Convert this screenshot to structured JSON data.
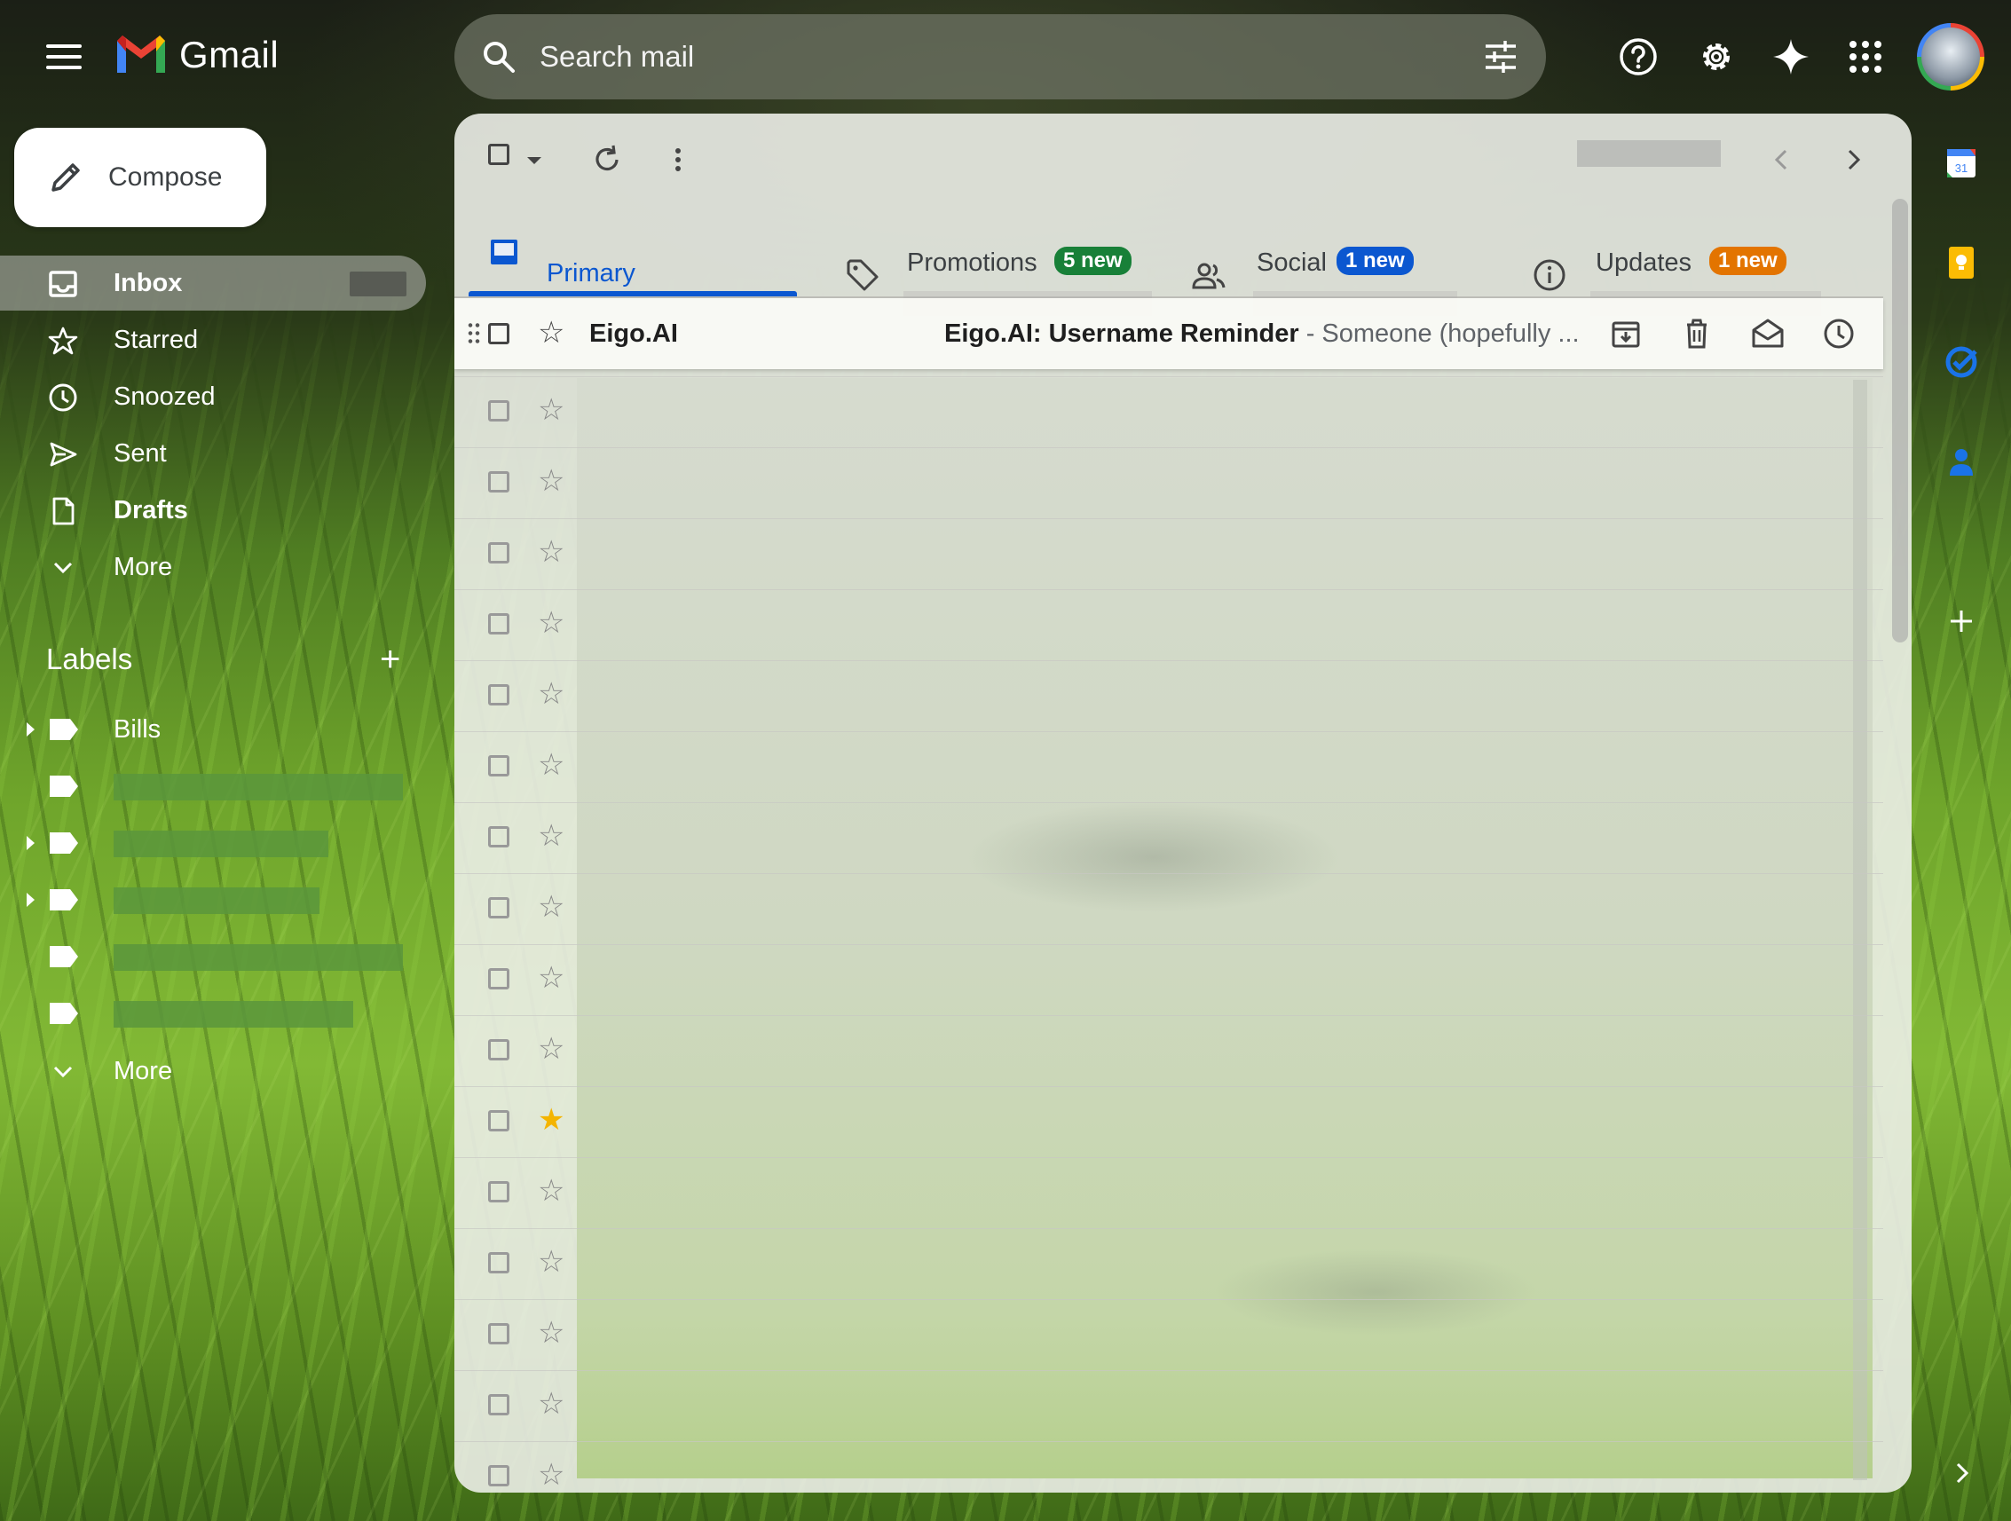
{
  "app": {
    "name": "Gmail"
  },
  "search": {
    "placeholder": "Search mail"
  },
  "compose": {
    "label": "Compose"
  },
  "nav": {
    "items": [
      {
        "label": "Inbox"
      },
      {
        "label": "Starred"
      },
      {
        "label": "Snoozed"
      },
      {
        "label": "Sent"
      },
      {
        "label": "Drafts"
      },
      {
        "label": "More"
      }
    ]
  },
  "labels": {
    "heading": "Labels",
    "items": [
      {
        "label": "Bills"
      }
    ],
    "more": "More"
  },
  "tabs": {
    "primary": {
      "label": "Primary"
    },
    "promotions": {
      "label": "Promotions",
      "badge": "5 new",
      "badge_color": "#188038"
    },
    "social": {
      "label": "Social",
      "badge": "1 new",
      "badge_color": "#0b57d0"
    },
    "updates": {
      "label": "Updates",
      "badge": "1 new",
      "badge_color": "#e37400"
    }
  },
  "emails": [
    {
      "sender": "Eigo.AI",
      "subject": "Eigo.AI: Username Reminder",
      "snippet": " - Someone (hopefully ..."
    }
  ],
  "colors": {
    "accent": "#0b57d0",
    "star_highlight": "#f4b400"
  },
  "icons": [
    "menu-icon",
    "gmail-logo-icon",
    "search-icon",
    "search-options-icon",
    "help-icon",
    "settings-icon",
    "gemini-icon",
    "apps-grid-icon",
    "pencil-icon",
    "inbox-icon",
    "star-icon",
    "clock-icon",
    "send-icon",
    "draft-icon",
    "chevron-down-icon",
    "plus-icon",
    "label-icon",
    "refresh-icon",
    "more-vert-icon",
    "chevron-left-icon",
    "chevron-right-icon",
    "tag-icon",
    "people-icon",
    "info-icon",
    "archive-icon",
    "trash-icon",
    "mark-read-icon",
    "snooze-icon",
    "calendar-icon",
    "keep-icon",
    "tasks-icon",
    "contacts-icon"
  ]
}
